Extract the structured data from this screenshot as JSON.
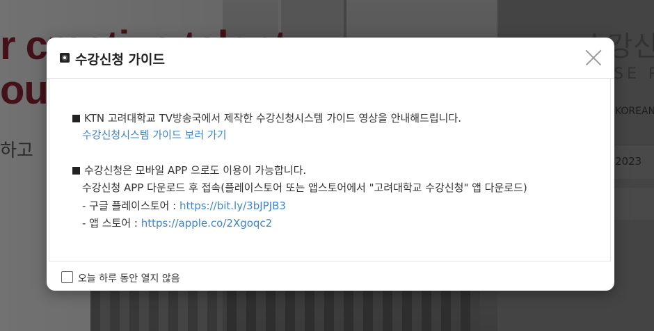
{
  "background": {
    "headline_1": "r creative talent",
    "headline_2": "out",
    "subtext": "하고",
    "right_title": "수강신청",
    "right_course": "SE R",
    "right_lang": "KOREAN",
    "right_field": "2023"
  },
  "modal": {
    "title": "수강신청 가이드",
    "close_icon": "close-icon",
    "section1": {
      "text": "KTN 고려대학교 TV방송국에서 제작한 수강신청시스템 가이드 영상을 안내해드립니다.",
      "link": "수강신청시스템 가이드 보러 가기"
    },
    "section2": {
      "text": "수강신청은 모바일 APP 으로도 이용이 가능합니다.",
      "detail": "수강신청 APP 다운로드 후 접속(플레이스토어 또는 앱스토어에서 \"고려대학교 수강신청\" 앱 다운로드)",
      "play_label": "- 구글 플레이스토어 : ",
      "play_link": "https://bit.ly/3bJPJB3",
      "apple_label": "- 앱 스토어 : ",
      "apple_link": "https://apple.co/2Xgoqc2"
    },
    "footer": {
      "checkbox_label": "오늘 하루 동안 열지 않음"
    }
  }
}
